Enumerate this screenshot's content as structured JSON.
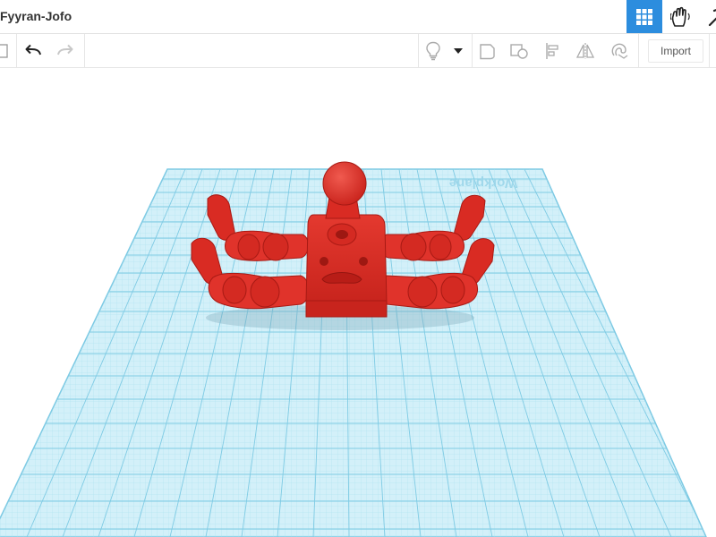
{
  "header": {
    "design_title": "Fyyran-Jofo",
    "view_buttons": [
      {
        "icon": "grid-view-icon",
        "active": true
      },
      {
        "icon": "hand-gesture-icon",
        "active": false
      },
      {
        "icon": "pickaxe-icon",
        "active": false
      }
    ]
  },
  "toolbar": {
    "undo_icon": "undo-icon",
    "redo_icon": "redo-icon",
    "import_label": "Import",
    "tools": [
      "light-bulb-icon",
      "dropdown-arrow-icon",
      "shape-solid-icon",
      "shape-hole-icon",
      "align-icon",
      "mirror-icon",
      "magnet-icon"
    ]
  },
  "workplane": {
    "label": "Workplane"
  },
  "colors": {
    "accent": "#2c8dde",
    "grid_fill": "#cdeef8",
    "grid_line": "#8fd3ea",
    "model": "#e0332b"
  }
}
